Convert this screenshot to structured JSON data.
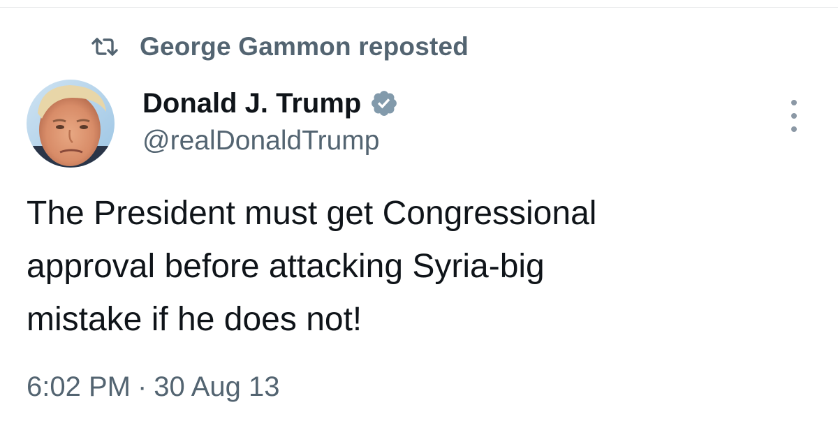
{
  "repost": {
    "text": "George Gammon reposted"
  },
  "author": {
    "display_name": "Donald J. Trump",
    "handle": "@realDonaldTrump",
    "verified": true
  },
  "tweet": {
    "lines": [
      "The President must get Congressional",
      "approval before attacking Syria-big",
      "mistake if he does not!"
    ]
  },
  "meta": {
    "time": "6:02 PM",
    "separator": "·",
    "date": "30 Aug 13"
  },
  "colors": {
    "text_primary": "#0f1419",
    "text_secondary": "#536471",
    "verified_badge": "#829aab"
  }
}
